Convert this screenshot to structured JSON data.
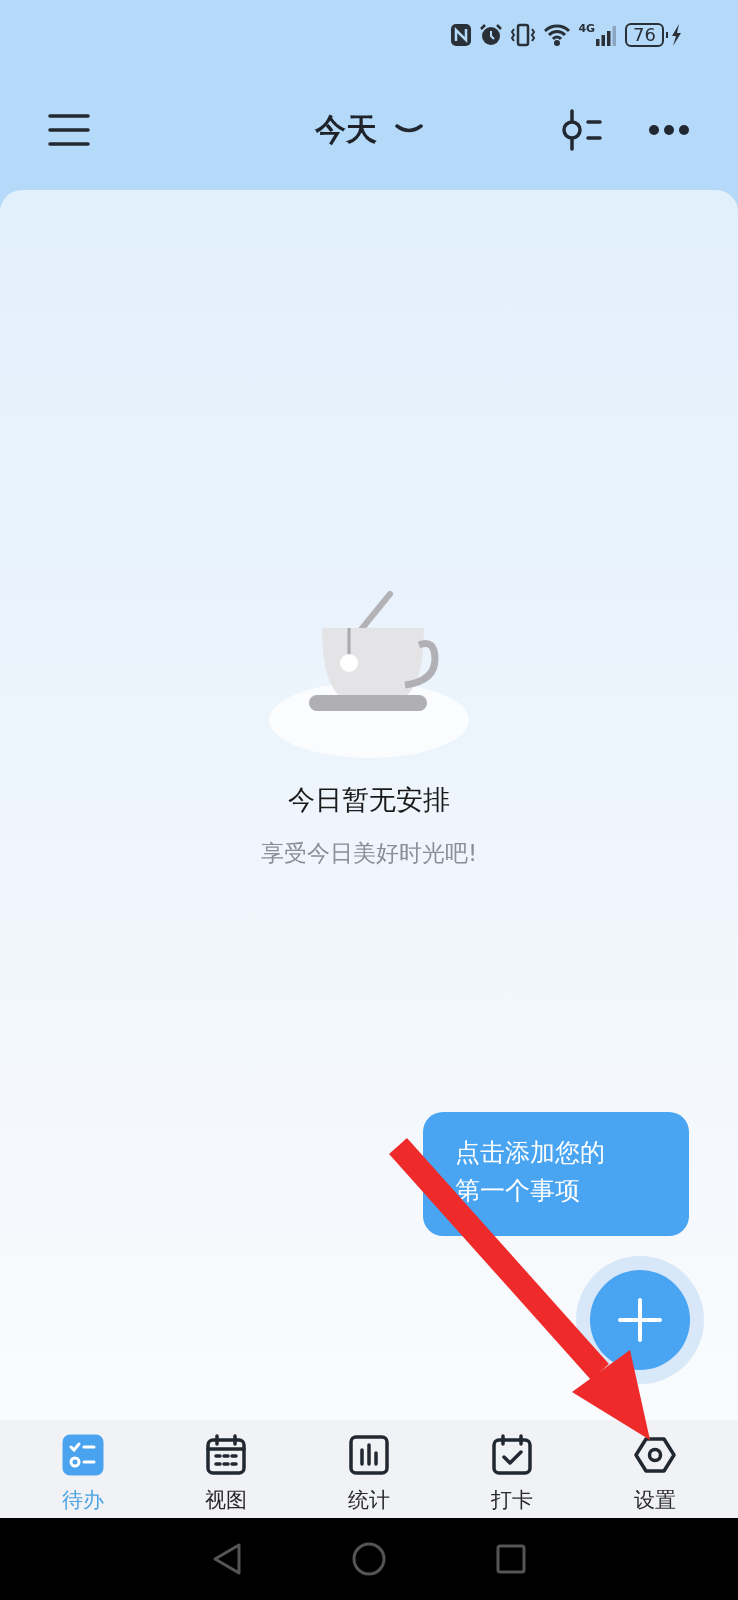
{
  "status_bar": {
    "network": "4G",
    "battery": "76"
  },
  "header": {
    "title": "今天"
  },
  "empty_state": {
    "title": "今日暂无安排",
    "subtitle": "享受今日美好时光吧!"
  },
  "tooltip": {
    "text": "点击添加您的第一个事项"
  },
  "tabs": [
    {
      "label": "待办",
      "selected": true
    },
    {
      "label": "视图",
      "selected": false
    },
    {
      "label": "统计",
      "selected": false
    },
    {
      "label": "打卡",
      "selected": false
    },
    {
      "label": "设置",
      "selected": false
    }
  ],
  "annotations": [
    {
      "kind": "arrow"
    }
  ]
}
